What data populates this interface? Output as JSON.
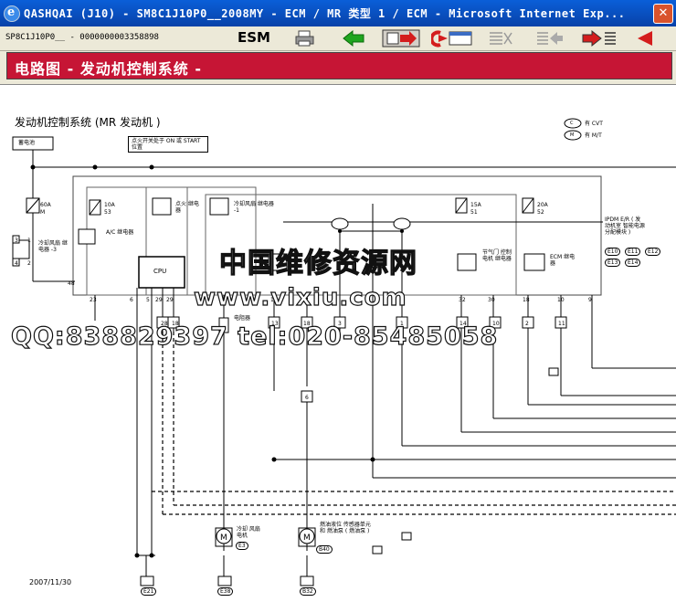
{
  "window": {
    "title": "QASHQAI (J10) - SM8C1J10P0__2008MY - ECM / MR 类型 1 / ECM - Microsoft Internet Exp...",
    "close_glyph": "✕"
  },
  "toolbar": {
    "doc_id": "SP8C1J10P0__ - 0000000003358898",
    "esm_label": "ESM"
  },
  "header": {
    "title": "电路图 - 发动机控制系统 -"
  },
  "diagram": {
    "title": "发动机控制系统 (MR 发动机 )",
    "date": "2007/11/30",
    "legend": {
      "cvt": "有 CVT",
      "cvt_mark": "C",
      "mt": "有 M/T",
      "mt_mark": "M"
    },
    "battery": "蓄电池",
    "ign_note": "点火开关处于 ON 或 START 位置",
    "fuse60": "60A",
    "fuse60_id": "M",
    "fuse10": "10A",
    "fuse10_id": "53",
    "fuse15": "15A",
    "fuse15_id": "51",
    "fuse20": "20A",
    "fuse20_id": "52",
    "relay_ac": "A/C 继电器",
    "relay_ign": "点火 继电器",
    "relay_fan1": "冷却风扇 继电器 -1",
    "relay_fan3": "冷却风扇 继电器 -3",
    "relay_throttle": "节气门 控制电机 继电器",
    "relay_ecm": "ECM 继电器",
    "cpu": "CPU",
    "resistor": "电阻器",
    "ipdm": "IPDM E/R ( 发动机室 智能电源 分配模块 )",
    "ipdm_conns": [
      "E10",
      "E11",
      "E12",
      "E13",
      "E14"
    ],
    "fan_motor": "冷却 风扇电机",
    "fuel_pump": "燃油液位 传感器单元和 燃油泵 ( 燃油泵 )",
    "bottom_conns": [
      "E21",
      "E38",
      "B32"
    ],
    "motor_conns": [
      "E3",
      "B40"
    ]
  },
  "watermark": {
    "line1": "中国维修资源网",
    "line2": "www.vixiu.com",
    "line3": "QQ:838829397  tel:020-85485058"
  }
}
